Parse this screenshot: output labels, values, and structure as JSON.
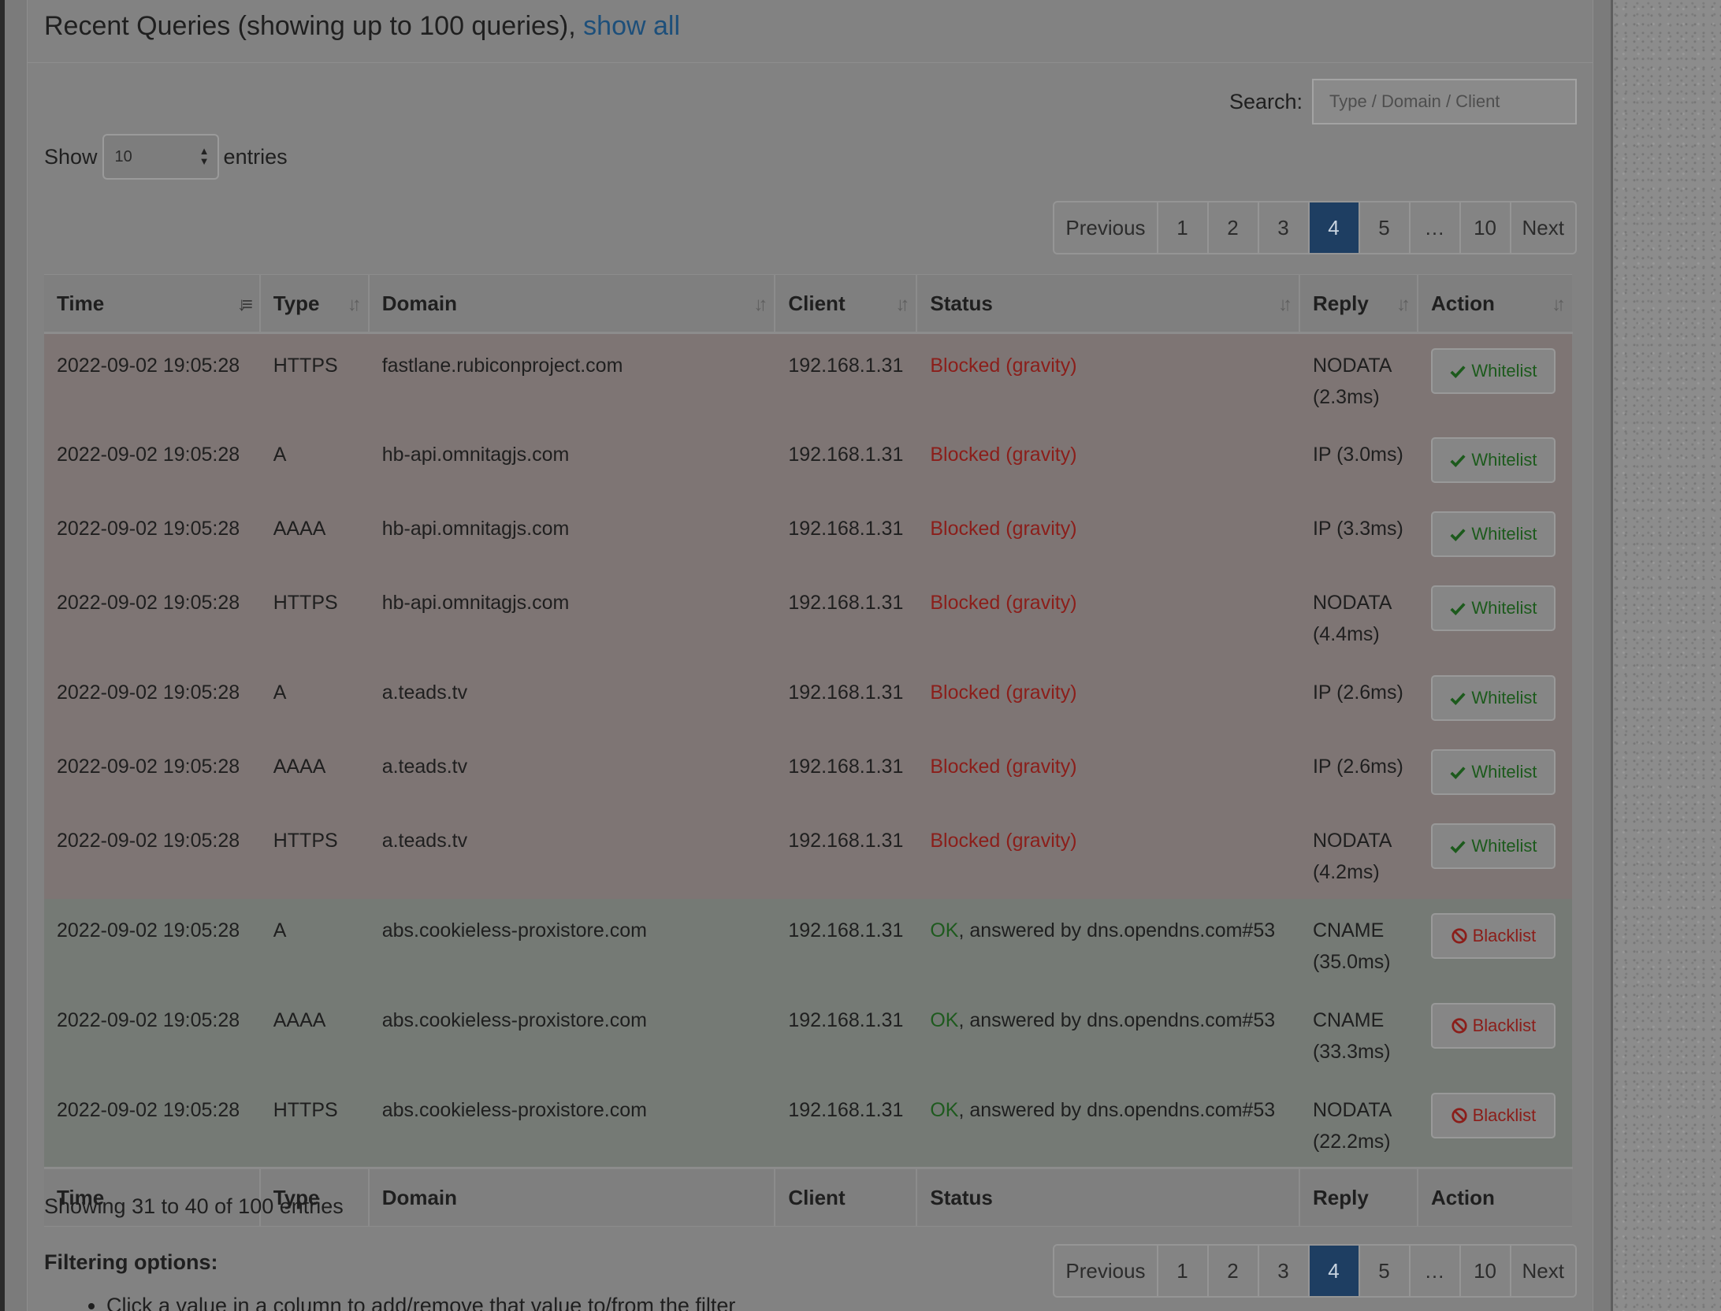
{
  "header": {
    "title": "Recent Queries (showing up to 100 queries), ",
    "show_all_link": "show all"
  },
  "search": {
    "label": "Search:",
    "placeholder": "Type / Domain / Client"
  },
  "length": {
    "show_label": "Show",
    "value": "10",
    "entries_label": "entries"
  },
  "pagination": {
    "previous": "Previous",
    "next": "Next",
    "pages": [
      "1",
      "2",
      "3",
      "4",
      "5",
      "…",
      "10"
    ],
    "active": "4"
  },
  "columns": [
    "Time",
    "Type",
    "Domain",
    "Client",
    "Status",
    "Reply",
    "Action"
  ],
  "rows": [
    {
      "time": "2022-09-02 19:05:28",
      "type": "HTTPS",
      "domain": "fastlane.rubiconproject.com",
      "client": "192.168.1.31",
      "status": "Blocked (gravity)",
      "status_kind": "blocked",
      "reply_line1": "NODATA",
      "reply_line2": "(2.3ms)",
      "action": "Whitelist"
    },
    {
      "time": "2022-09-02 19:05:28",
      "type": "A",
      "domain": "hb-api.omnitagjs.com",
      "client": "192.168.1.31",
      "status": "Blocked (gravity)",
      "status_kind": "blocked",
      "reply_line1": "IP (3.0ms)",
      "reply_line2": "",
      "action": "Whitelist"
    },
    {
      "time": "2022-09-02 19:05:28",
      "type": "AAAA",
      "domain": "hb-api.omnitagjs.com",
      "client": "192.168.1.31",
      "status": "Blocked (gravity)",
      "status_kind": "blocked",
      "reply_line1": "IP (3.3ms)",
      "reply_line2": "",
      "action": "Whitelist"
    },
    {
      "time": "2022-09-02 19:05:28",
      "type": "HTTPS",
      "domain": "hb-api.omnitagjs.com",
      "client": "192.168.1.31",
      "status": "Blocked (gravity)",
      "status_kind": "blocked",
      "reply_line1": "NODATA",
      "reply_line2": "(4.4ms)",
      "action": "Whitelist"
    },
    {
      "time": "2022-09-02 19:05:28",
      "type": "A",
      "domain": "a.teads.tv",
      "client": "192.168.1.31",
      "status": "Blocked (gravity)",
      "status_kind": "blocked",
      "reply_line1": "IP (2.6ms)",
      "reply_line2": "",
      "action": "Whitelist"
    },
    {
      "time": "2022-09-02 19:05:28",
      "type": "AAAA",
      "domain": "a.teads.tv",
      "client": "192.168.1.31",
      "status": "Blocked (gravity)",
      "status_kind": "blocked",
      "reply_line1": "IP (2.6ms)",
      "reply_line2": "",
      "action": "Whitelist"
    },
    {
      "time": "2022-09-02 19:05:28",
      "type": "HTTPS",
      "domain": "a.teads.tv",
      "client": "192.168.1.31",
      "status": "Blocked (gravity)",
      "status_kind": "blocked",
      "reply_line1": "NODATA",
      "reply_line2": "(4.2ms)",
      "action": "Whitelist"
    },
    {
      "time": "2022-09-02 19:05:28",
      "type": "A",
      "domain": "abs.cookieless-proxistore.com",
      "client": "192.168.1.31",
      "status_ok": "OK",
      "status_rest": ", answered by dns.opendns.com#53",
      "status_kind": "ok",
      "reply_line1": "CNAME",
      "reply_line2": "(35.0ms)",
      "action": "Blacklist"
    },
    {
      "time": "2022-09-02 19:05:28",
      "type": "AAAA",
      "domain": "abs.cookieless-proxistore.com",
      "client": "192.168.1.31",
      "status_ok": "OK",
      "status_rest": ", answered by dns.opendns.com#53",
      "status_kind": "ok",
      "reply_line1": "CNAME",
      "reply_line2": "(33.3ms)",
      "action": "Blacklist"
    },
    {
      "time": "2022-09-02 19:05:28",
      "type": "HTTPS",
      "domain": "abs.cookieless-proxistore.com",
      "client": "192.168.1.31",
      "status_ok": "OK",
      "status_rest": ", answered by dns.opendns.com#53",
      "status_kind": "ok",
      "reply_line1": "NODATA",
      "reply_line2": "(22.2ms)",
      "action": "Blacklist"
    }
  ],
  "info": "Showing 31 to 40 of 100 entries",
  "filtering": {
    "title": "Filtering options:",
    "items": [
      "Click a value in a column to add/remove that value to/from the filter"
    ]
  },
  "icons": {
    "whitelist": "check-icon",
    "blacklist": "ban-icon",
    "sort": "sort-icon"
  },
  "colors": {
    "active_page": "#1e3e62",
    "blocked": "#8b1e1a",
    "ok": "#1e5a1e",
    "link": "#1d4f7a"
  }
}
